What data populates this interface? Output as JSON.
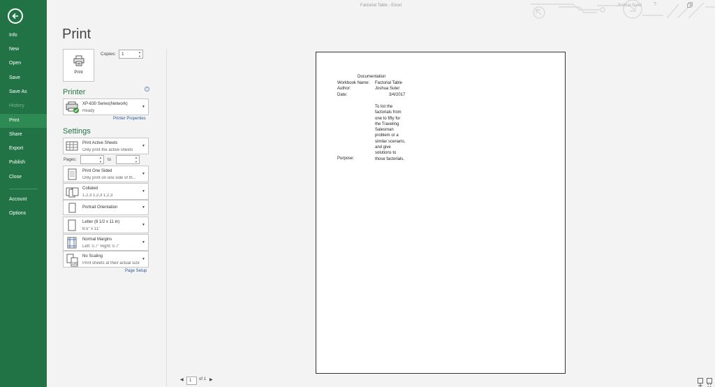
{
  "window": {
    "title": "Factorial Table - Excel",
    "user": "Joshua Suter",
    "help": "?"
  },
  "sidebar": {
    "items": [
      {
        "label": "Info"
      },
      {
        "label": "New"
      },
      {
        "label": "Open"
      },
      {
        "label": "Save"
      },
      {
        "label": "Save As"
      },
      {
        "label": "History"
      },
      {
        "label": "Print"
      },
      {
        "label": "Share"
      },
      {
        "label": "Export"
      },
      {
        "label": "Publish"
      },
      {
        "label": "Close"
      },
      {
        "label": "Account"
      },
      {
        "label": "Options"
      }
    ]
  },
  "print": {
    "heading": "Print",
    "button_label": "Print",
    "copies_label": "Copies:",
    "copies_value": "1"
  },
  "printer": {
    "heading": "Printer",
    "name": "XP-630 Series(Network)",
    "status": "Ready",
    "properties_link": "Printer Properties"
  },
  "settings": {
    "heading": "Settings",
    "what": {
      "title": "Print Active Sheets",
      "sub": "Only print the active sheets"
    },
    "pages_label": "Pages:",
    "to_label": "to",
    "sides": {
      "title": "Print One Sided",
      "sub": "Only print on one side of th..."
    },
    "collation": {
      "title": "Collated",
      "sub": "1,2,3    1,2,3    1,2,3"
    },
    "orientation": {
      "title": "Portrait Orientation"
    },
    "paper": {
      "title": "Letter (8 1/2 x 11 in)",
      "sub": "8.5\" x 11\""
    },
    "margins": {
      "title": "Normal Margins",
      "sub": "Left:  0.7\"    Right:  0.7\""
    },
    "scaling": {
      "title": "No Scaling",
      "sub": "Print sheets at their actual size",
      "icon_text": "100"
    },
    "page_setup_link": "Page Setup"
  },
  "preview": {
    "heading": "Documentation",
    "rows": [
      {
        "label": "Workbook Name:",
        "value": "Factorial Table"
      },
      {
        "label": "Author:",
        "value": "Joshua Suter"
      },
      {
        "label": "Date:",
        "value": "3/4/2017"
      }
    ],
    "purpose_label": "Purpose:",
    "purpose_lines": [
      "To list the",
      "factorials from",
      "one to fifty for",
      "the Traveling",
      "Salesman",
      "problem or a",
      "similar scenario,",
      "and give",
      "solutions to",
      "those factorials."
    ]
  },
  "pager": {
    "current": "1",
    "of_total": "of 1"
  }
}
